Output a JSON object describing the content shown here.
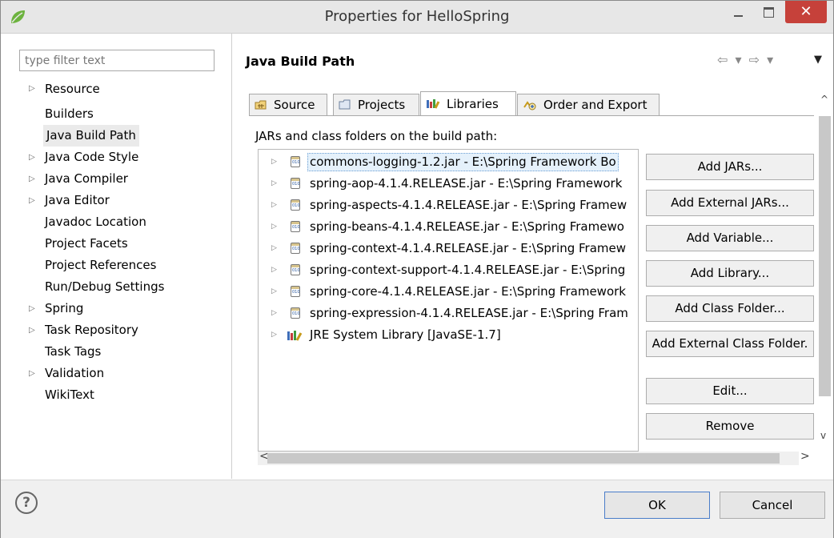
{
  "window": {
    "title": "Properties for HelloSpring",
    "close_glyph": "✕"
  },
  "filter": {
    "placeholder": "type filter text"
  },
  "sidebar": {
    "items": [
      {
        "label": "Resource",
        "expandable": true
      },
      {
        "label": "Builders",
        "expandable": false
      },
      {
        "label": "Java Build Path",
        "expandable": false,
        "selected": true
      },
      {
        "label": "Java Code Style",
        "expandable": true
      },
      {
        "label": "Java Compiler",
        "expandable": true
      },
      {
        "label": "Java Editor",
        "expandable": true
      },
      {
        "label": "Javadoc Location",
        "expandable": false
      },
      {
        "label": "Project Facets",
        "expandable": false
      },
      {
        "label": "Project References",
        "expandable": false
      },
      {
        "label": "Run/Debug Settings",
        "expandable": false
      },
      {
        "label": "Spring",
        "expandable": true
      },
      {
        "label": "Task Repository",
        "expandable": true
      },
      {
        "label": "Task Tags",
        "expandable": false
      },
      {
        "label": "Validation",
        "expandable": true
      },
      {
        "label": "WikiText",
        "expandable": false
      }
    ],
    "twisty": "▷"
  },
  "page": {
    "title": "Java Build Path",
    "history": "⇦ ▾ ⇨ ▾",
    "view_menu": "▼"
  },
  "tabs": [
    {
      "label": "Source",
      "icon": "source-icon"
    },
    {
      "label": "Projects",
      "icon": "folder-icon"
    },
    {
      "label": "Libraries",
      "icon": "library-icon",
      "active": true
    },
    {
      "label": "Order and Export",
      "icon": "order-icon"
    }
  ],
  "libraries": {
    "label": "JARs and class folders on the build path:",
    "rows": [
      {
        "text": "commons-logging-1.2.jar - E:\\Spring Framework Bo",
        "icon": "jar-icon",
        "selected": true
      },
      {
        "text": "spring-aop-4.1.4.RELEASE.jar - E:\\Spring Framework",
        "icon": "jar-icon"
      },
      {
        "text": "spring-aspects-4.1.4.RELEASE.jar - E:\\Spring Framew",
        "icon": "jar-icon"
      },
      {
        "text": "spring-beans-4.1.4.RELEASE.jar - E:\\Spring Framewo",
        "icon": "jar-icon"
      },
      {
        "text": "spring-context-4.1.4.RELEASE.jar - E:\\Spring Framew",
        "icon": "jar-icon"
      },
      {
        "text": "spring-context-support-4.1.4.RELEASE.jar - E:\\Spring",
        "icon": "jar-icon"
      },
      {
        "text": "spring-core-4.1.4.RELEASE.jar - E:\\Spring Framework",
        "icon": "jar-icon"
      },
      {
        "text": "spring-expression-4.1.4.RELEASE.jar - E:\\Spring Fram",
        "icon": "jar-icon"
      },
      {
        "text": "JRE System Library [JavaSE-1.7]",
        "icon": "library-icon"
      }
    ]
  },
  "buttons": {
    "add_jars": "Add JARs...",
    "add_external_jars": "Add External JARs...",
    "add_variable": "Add Variable...",
    "add_library": "Add Library...",
    "add_class_folder": "Add Class Folder...",
    "add_external_class_folder": "Add External Class Folder.",
    "edit": "Edit...",
    "remove": "Remove"
  },
  "footer": {
    "help": "?",
    "ok": "OK",
    "cancel": "Cancel"
  },
  "colors": {
    "close_button": "#c6413a",
    "selection_fill": "#e5f1fb",
    "selection_border": "#6a9fd4",
    "spring_green": "#6db33f"
  }
}
